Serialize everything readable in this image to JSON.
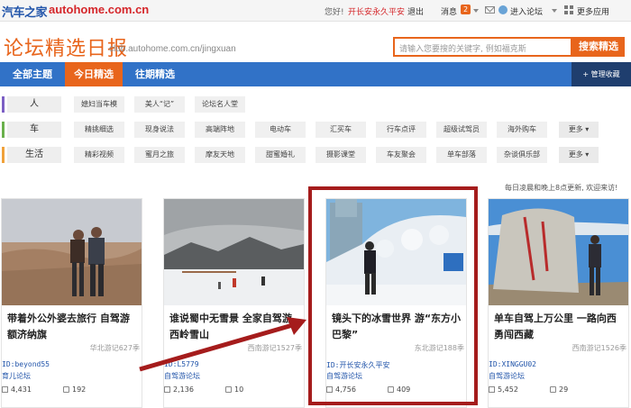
{
  "topbar": {
    "logo_cn": "汽车之家",
    "logo_domain": "autohome.com.cn",
    "greeting": "您好!",
    "username": "开长安永久平安",
    "logout": "退出",
    "messages": "消息",
    "message_count": "2",
    "enter_forum": "进入论坛",
    "more_apps": "更多应用"
  },
  "header": {
    "title": "论坛精选日报",
    "url": "club.autohome.com.cn/jingxuan",
    "search_placeholder": "请输入您要搜的关键字, 例如福克斯",
    "search_button": "搜索精选"
  },
  "nav": {
    "tabs": [
      "全部主题",
      "今日精选",
      "往期精选"
    ],
    "active": "今日精选",
    "favorites": "+ 管理收藏"
  },
  "categories": [
    {
      "label": "人",
      "color": "#7c5fc4",
      "chips": [
        "媳妇当车模",
        "美人“记”",
        "论坛名人堂"
      ]
    },
    {
      "label": "车",
      "color": "#6ab04c",
      "chips": [
        "精挑细选",
        "现身说法",
        "高端阵地",
        "电动车",
        "汇买车",
        "行车点评",
        "超级试驾员",
        "海外购车"
      ],
      "more": "更多"
    },
    {
      "label": "生活",
      "color": "#f0a13a",
      "chips": [
        "精彩视频",
        "蜜月之旅",
        "摩友天地",
        "甜蜜婚礼",
        "摄影课堂",
        "车友聚会",
        "单车部落",
        "杂谈俱乐部"
      ],
      "more": "更多"
    }
  ],
  "notice": "每日凌晨和晚上8点更新, 欢迎来访!",
  "cards": [
    {
      "title": "带着外公外婆去旅行 自驾游额济纳旗",
      "region": "华北游记627季",
      "author": "ID:beyond55",
      "forum": "育儿论坛",
      "views": "4,431",
      "replies": "192"
    },
    {
      "title": "谁说蜀中无雪景 全家自驾游西岭雪山",
      "region": "西南游记1527季",
      "author": "ID:L5779",
      "forum": "自驾游论坛",
      "views": "2,136",
      "replies": "10"
    },
    {
      "title": "镜头下的冰雪世界 游“东方小巴黎”",
      "region": "东北游记188季",
      "author": "ID:开长安永久平安",
      "forum": "自驾游论坛",
      "views": "4,756",
      "replies": "409"
    },
    {
      "title": "单车自驾上万公里 一路向西勇闯西藏",
      "region": "西南游记1526季",
      "author": "ID:XINGGU02",
      "forum": "自驾游论坛",
      "views": "5,452",
      "replies": "29"
    }
  ]
}
